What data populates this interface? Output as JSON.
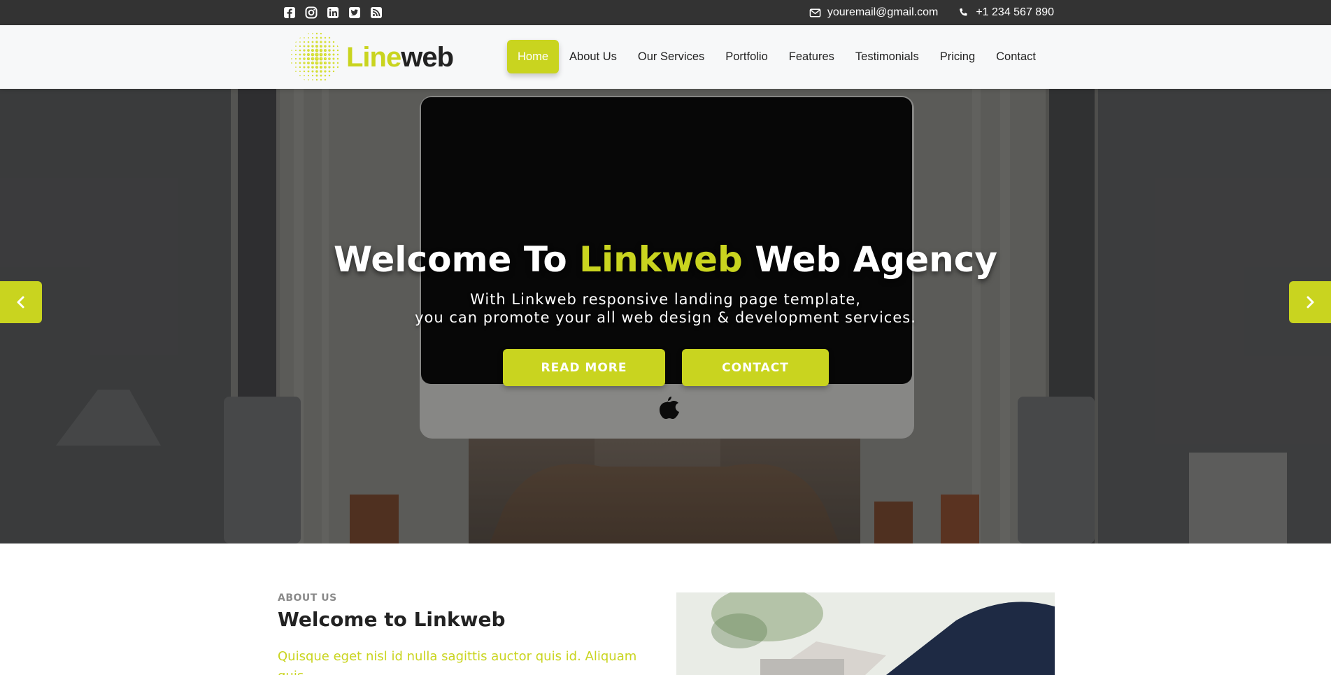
{
  "topbar": {
    "social": [
      {
        "icon": "facebook-icon"
      },
      {
        "icon": "instagram-icon"
      },
      {
        "icon": "linkedin-icon"
      },
      {
        "icon": "twitter-icon"
      },
      {
        "icon": "rss-icon"
      }
    ],
    "email": "youremail@gmail.com",
    "phone": "+1 234 567 890"
  },
  "header": {
    "logo": {
      "part1": "Line",
      "part2": "web"
    },
    "nav": [
      {
        "label": "Home",
        "active": true
      },
      {
        "label": "About Us"
      },
      {
        "label": "Our Services"
      },
      {
        "label": "Portfolio"
      },
      {
        "label": "Features"
      },
      {
        "label": "Testimonials"
      },
      {
        "label": "Pricing"
      },
      {
        "label": "Contact"
      }
    ]
  },
  "hero": {
    "title_before": "Welcome To ",
    "title_accent": "Linkweb",
    "title_after": " Web Agency",
    "subtitle_line1": "With Linkweb responsive landing page template,",
    "subtitle_line2": "you can promote your all web design & development services.",
    "button_readmore": "READ MORE",
    "button_contact": "CONTACT"
  },
  "about": {
    "label": "ABOUT US",
    "title": "Welcome to Linkweb",
    "text": "Quisque eget nisl id nulla sagittis auctor quis id. Aliquam quis"
  },
  "colors": {
    "accent": "#c9d41f",
    "topbar": "#333333",
    "header_bg": "#f7f8f9"
  }
}
